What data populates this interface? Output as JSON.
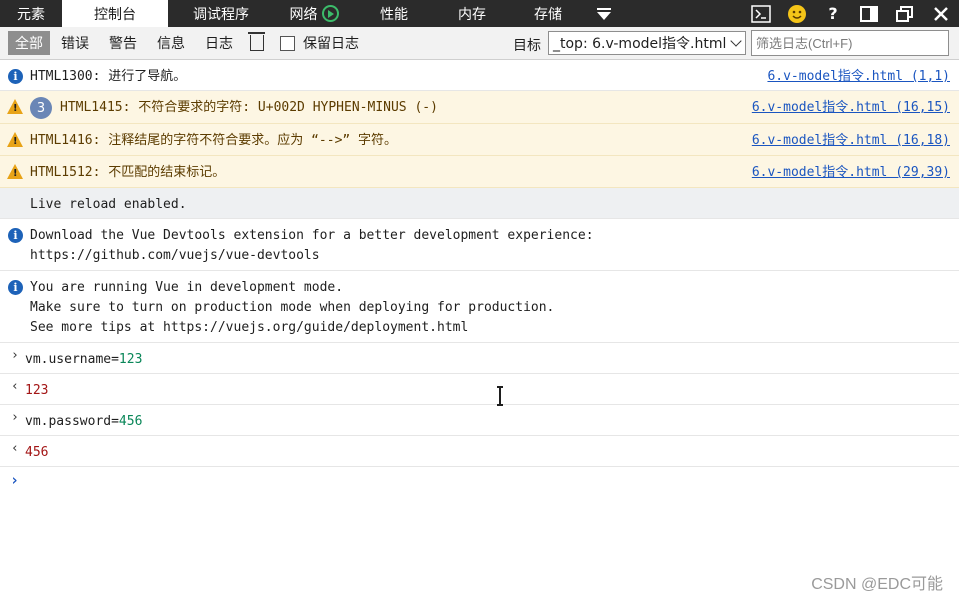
{
  "tabs": [
    {
      "label": "元素",
      "active": false
    },
    {
      "label": "控制台",
      "active": true
    },
    {
      "label": "调试程序",
      "active": false
    },
    {
      "label": "网络",
      "active": false
    },
    {
      "label": "性能",
      "active": false
    },
    {
      "label": "内存",
      "active": false
    },
    {
      "label": "存储",
      "active": false
    }
  ],
  "tabbar_icons": [
    "dropdown-icon",
    "console-icon",
    "smiley-feedback-icon",
    "help-icon",
    "dock-icon",
    "restore-window-icon",
    "close-icon"
  ],
  "toolbar": {
    "filters": [
      "全部",
      "错误",
      "警告",
      "信息",
      "日志"
    ],
    "keep_log_label": "保留日志",
    "target_label": "目标",
    "target_value": "_top: 6.v-model指令.html",
    "filter_placeholder": "筛选日志(Ctrl+F)"
  },
  "messages": [
    {
      "type": "info",
      "text": "HTML1300: 进行了导航。",
      "source": "6.v-model指令.html (1,1)"
    },
    {
      "type": "warn",
      "count": "3",
      "text": "HTML1415: 不符合要求的字符: U+002D HYPHEN-MINUS (-)",
      "source": "6.v-model指令.html (16,15)"
    },
    {
      "type": "warn",
      "text": "HTML1416: 注释结尾的字符不符合要求。应为 “-->” 字符。",
      "source": "6.v-model指令.html (16,18)"
    },
    {
      "type": "warn",
      "text": "HTML1512: 不匹配的结束标记。",
      "source": "6.v-model指令.html (29,39)"
    },
    {
      "type": "log",
      "text": "Live reload enabled."
    },
    {
      "type": "info",
      "text": "Download the Vue Devtools extension for a better development experience:\nhttps://github.com/vuejs/vue-devtools"
    },
    {
      "type": "info",
      "text": "You are running Vue in development mode.\nMake sure to turn on production mode when deploying for production.\nSee more tips at https://vuejs.org/guide/deployment.html"
    }
  ],
  "commands": [
    {
      "input_prefix": "vm.username=",
      "input_value": "123",
      "result": "123"
    },
    {
      "input_prefix": "vm.password=",
      "input_value": "456",
      "result": "456"
    }
  ],
  "watermark": "CSDN @EDC可能",
  "colors": {
    "accent": "#1d62b8",
    "warn": "#e8a317",
    "warn_bg": "#fdf6e3",
    "number": "#098658",
    "result": "#a31515"
  }
}
